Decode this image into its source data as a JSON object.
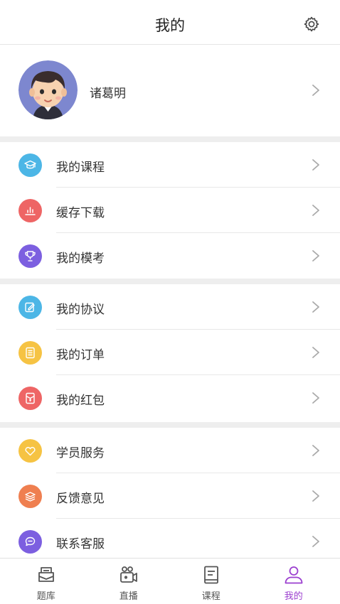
{
  "header": {
    "title": "我的"
  },
  "profile": {
    "name": "诸葛明"
  },
  "groups": [
    [
      {
        "label": "我的课程",
        "icon": "graduation-cap-icon",
        "color": "#4cb6e6"
      },
      {
        "label": "缓存下载",
        "icon": "bar-chart-icon",
        "color": "#ee6565"
      },
      {
        "label": "我的模考",
        "icon": "trophy-icon",
        "color": "#7c5fe0"
      }
    ],
    [
      {
        "label": "我的协议",
        "icon": "edit-doc-icon",
        "color": "#4cb6e6"
      },
      {
        "label": "我的订单",
        "icon": "order-list-icon",
        "color": "#f6c343"
      },
      {
        "label": "我的红包",
        "icon": "red-packet-icon",
        "color": "#ee6565"
      }
    ],
    [
      {
        "label": "学员服务",
        "icon": "heart-service-icon",
        "color": "#f6c343"
      },
      {
        "label": "反馈意见",
        "icon": "feedback-stack-icon",
        "color": "#ef7f50"
      },
      {
        "label": "联系客服",
        "icon": "chat-bubble-icon",
        "color": "#7c5fe0"
      }
    ]
  ],
  "tabs": [
    {
      "label": "题库",
      "icon": "question-bank-icon"
    },
    {
      "label": "直播",
      "icon": "video-camera-icon"
    },
    {
      "label": "课程",
      "icon": "course-book-icon"
    },
    {
      "label": "我的",
      "icon": "user-profile-icon",
      "active": true
    }
  ],
  "colors": {
    "accent": "#9b3fcf",
    "separator": "#eeeeee"
  }
}
